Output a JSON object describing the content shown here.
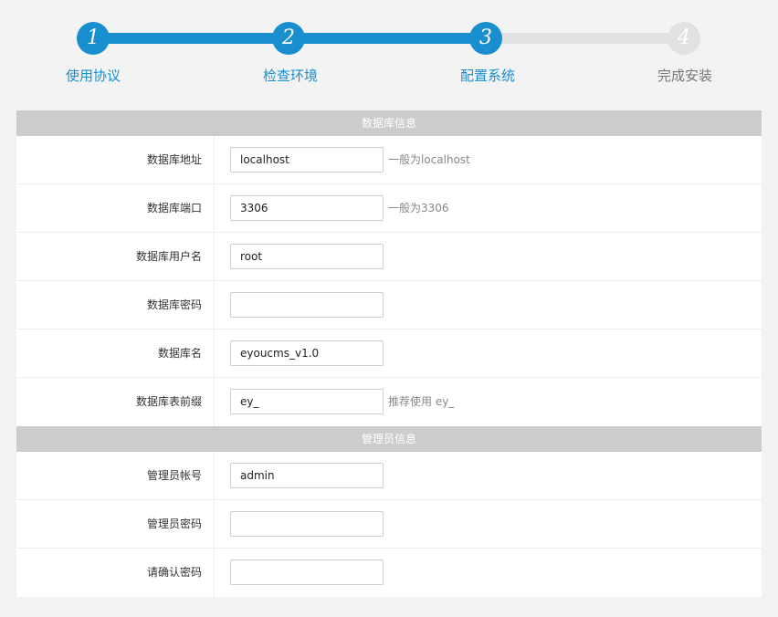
{
  "steps": [
    {
      "number": "1",
      "label": "使用协议",
      "state": "done"
    },
    {
      "number": "2",
      "label": "检查环境",
      "state": "done"
    },
    {
      "number": "3",
      "label": "配置系统",
      "state": "done"
    },
    {
      "number": "4",
      "label": "完成安装",
      "state": "todo"
    }
  ],
  "colors": {
    "accent": "#1a8fd0",
    "inactive": "#e2e2e2",
    "section_header_bg": "#cccccc"
  },
  "database": {
    "title": "数据库信息",
    "fields": [
      {
        "label": "数据库地址",
        "value": "localhost",
        "hint": "一般为localhost"
      },
      {
        "label": "数据库端口",
        "value": "3306",
        "hint": "一般为3306"
      },
      {
        "label": "数据库用户名",
        "value": "root",
        "hint": ""
      },
      {
        "label": "数据库密码",
        "value": "",
        "hint": ""
      },
      {
        "label": "数据库名",
        "value": "eyoucms_v1.0",
        "hint": ""
      },
      {
        "label": "数据库表前缀",
        "value": "ey_",
        "hint": "推荐使用 ey_"
      }
    ]
  },
  "admin": {
    "title": "管理员信息",
    "fields": [
      {
        "label": "管理员帐号",
        "value": "admin"
      },
      {
        "label": "管理员密码",
        "value": ""
      },
      {
        "label": "请确认密码",
        "value": ""
      }
    ]
  }
}
